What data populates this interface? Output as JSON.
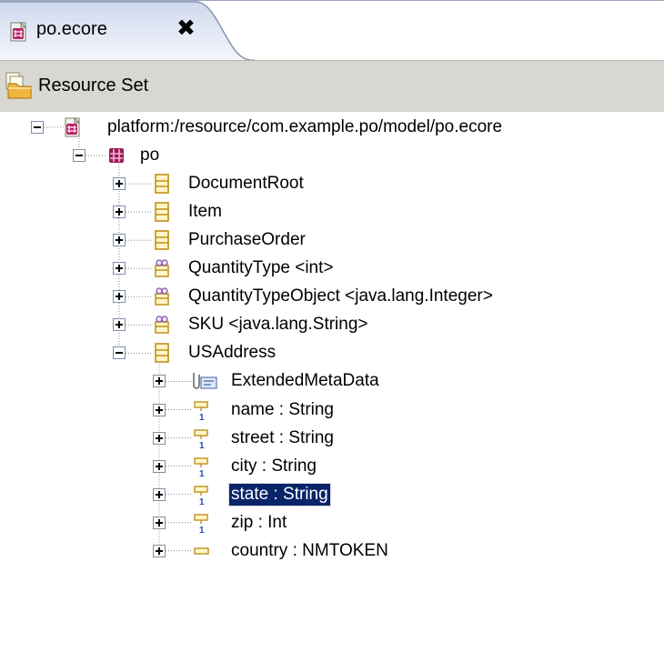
{
  "tab": {
    "title": "po.ecore",
    "close_glyph": "✖"
  },
  "header": {
    "title": "Resource Set"
  },
  "tree": [
    {
      "label": "platform:/resource/com.example.po/model/po.ecore",
      "icon": "ecore-file-icon",
      "depth": 0,
      "toggle": "minus"
    },
    {
      "label": "po",
      "icon": "epackage-icon",
      "depth": 1,
      "toggle": "minus"
    },
    {
      "label": "DocumentRoot",
      "icon": "eclass-icon",
      "depth": 2,
      "toggle": "plus"
    },
    {
      "label": "Item",
      "icon": "eclass-icon",
      "depth": 2,
      "toggle": "plus"
    },
    {
      "label": "PurchaseOrder",
      "icon": "eclass-icon",
      "depth": 2,
      "toggle": "plus"
    },
    {
      "label": "QuantityType <int>",
      "icon": "edatatype-icon",
      "depth": 2,
      "toggle": "plus"
    },
    {
      "label": "QuantityTypeObject <java.lang.Integer>",
      "icon": "edatatype-icon",
      "depth": 2,
      "toggle": "plus"
    },
    {
      "label": "SKU <java.lang.String>",
      "icon": "edatatype-icon",
      "depth": 2,
      "toggle": "plus"
    },
    {
      "label": "USAddress",
      "icon": "eclass-icon",
      "depth": 2,
      "toggle": "minus"
    },
    {
      "label": "ExtendedMetaData",
      "icon": "eannotation-icon",
      "depth": 3,
      "toggle": "plus"
    },
    {
      "label": "name : String",
      "icon": "eattribute-icon",
      "depth": 3,
      "toggle": "plus"
    },
    {
      "label": "street : String",
      "icon": "eattribute-icon",
      "depth": 3,
      "toggle": "plus"
    },
    {
      "label": "city : String",
      "icon": "eattribute-icon",
      "depth": 3,
      "toggle": "plus"
    },
    {
      "label": "state : String",
      "icon": "eattribute-icon",
      "depth": 3,
      "toggle": "plus",
      "selected": true
    },
    {
      "label": "zip : Int",
      "icon": "eattribute-icon",
      "depth": 3,
      "toggle": "plus"
    },
    {
      "label": "country : NMTOKEN",
      "icon": "eattribute-optional-icon",
      "depth": 3,
      "toggle": "plus"
    }
  ],
  "colors": {
    "selection": "#0a246a",
    "header_bg": "#d9d7d1",
    "package": "#9b1b5a",
    "class": "#c8a030"
  }
}
